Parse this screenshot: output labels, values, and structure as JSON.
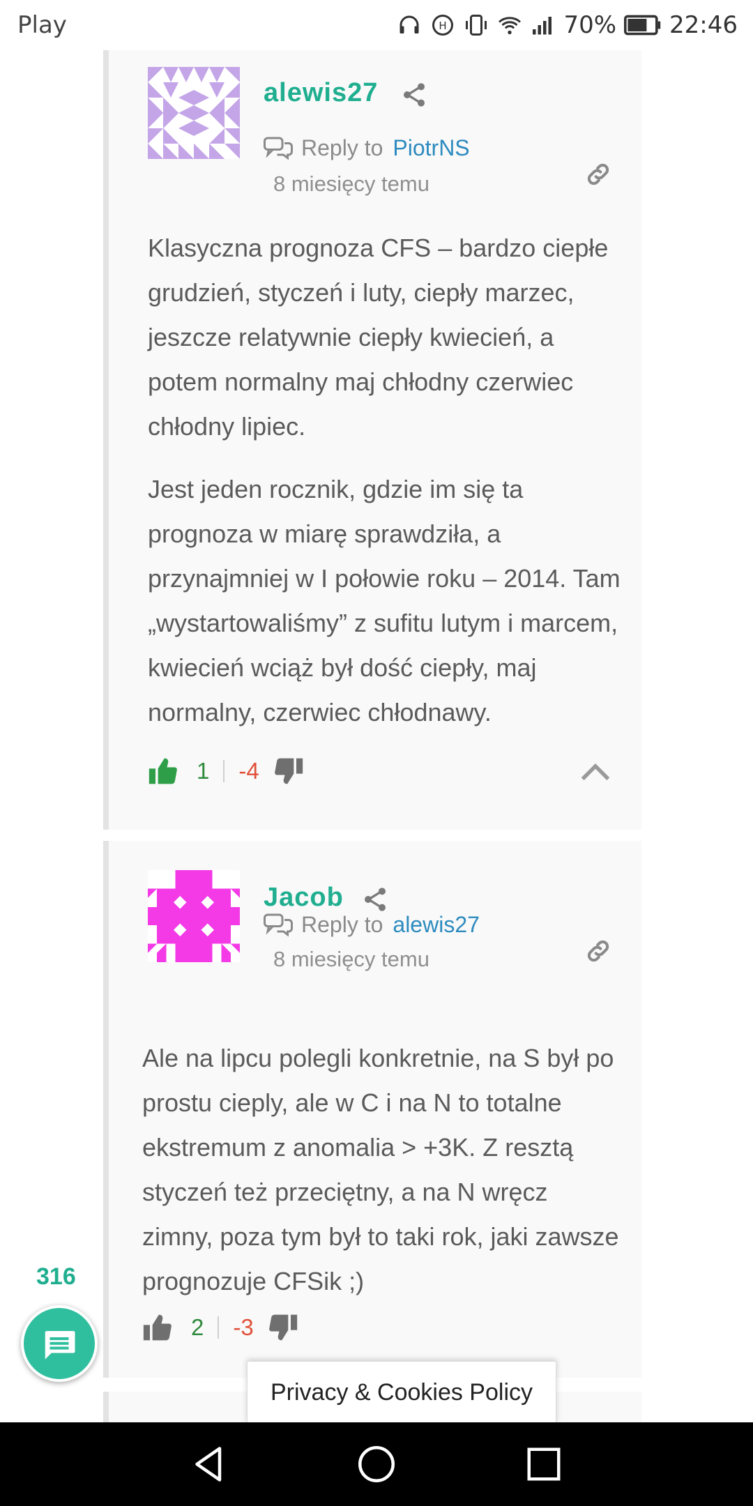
{
  "status_bar": {
    "carrier": "Play",
    "battery": "70%",
    "time": "22:46",
    "icons": [
      "headset-icon",
      "data-saver-icon",
      "vibrate-icon",
      "wifi-icon",
      "signal-icon",
      "battery-icon"
    ]
  },
  "comments": [
    {
      "author": "alewis27",
      "reply_label": "Reply to",
      "reply_to": "PiotrNS",
      "time": "8 miesięcy temu",
      "avatar_color": "#c3a5e8",
      "paragraphs": [
        "Klasyczna prognoza CFS – bardzo ciepłe grudzień, styczeń i luty, ciepły marzec, jeszcze relatywnie ciepły kwiecień, a potem normalny maj chłodny czerwiec chłodny lipiec.",
        "Jest jeden rocznik, gdzie im się ta prognoza w miarę sprawdziła, a przynajmniej w I połowie roku – 2014. Tam „wystartowaliśmy” z sufitu lutym i marcem, kwiecień wciąż był dość ciepły, maj normalny, czerwiec chłodnawy."
      ],
      "upvotes": "1",
      "downvotes": "-4"
    },
    {
      "author": "Jacob",
      "reply_label": "Reply to",
      "reply_to": "alewis27",
      "time": "8 miesięcy temu",
      "avatar_color": "#f33ae6",
      "paragraphs": [
        "Ale na lipcu polegli konkretnie, na S był po prostu cieply, ale w C i na N to totalne ekstremum z anomalia > +3K. Z resztą styczeń też przeciętny, a na N wręcz zimny, poza tym był to taki rok, jaki zawsze prognozuje CFSik ;)"
      ],
      "upvotes": "2",
      "downvotes": "-3"
    }
  ],
  "comment_count": "316",
  "privacy_label": "Privacy & Cookies Policy",
  "colors": {
    "accent": "#1fae8f",
    "link": "#2d8bbf",
    "upvote": "#2e8a3c",
    "downvote": "#e0513a"
  }
}
